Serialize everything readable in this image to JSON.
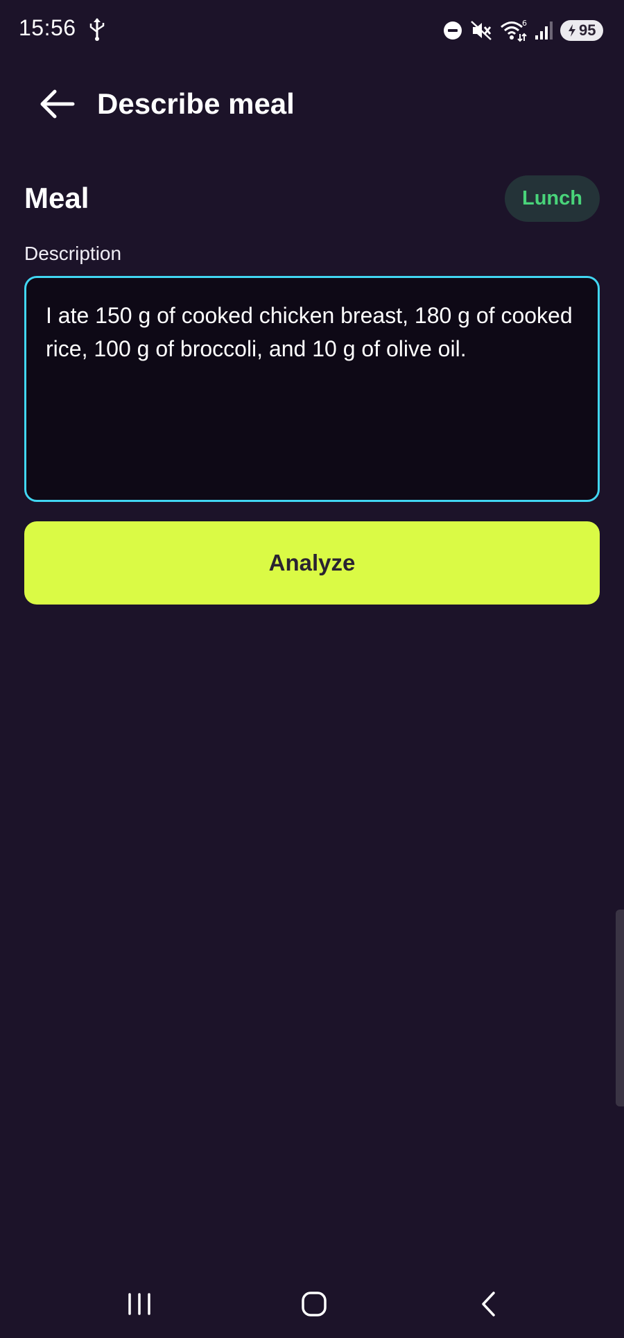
{
  "status_bar": {
    "time": "15:56",
    "battery": "95",
    "icons": [
      "usb-icon",
      "do-not-disturb-icon",
      "mute-icon",
      "wifi-icon",
      "signal-icon",
      "battery-charging-icon"
    ],
    "wifi_badge": "6"
  },
  "app_bar": {
    "title": "Describe meal",
    "back_icon": "arrow-left-icon"
  },
  "meal": {
    "heading": "Meal",
    "type_chip": "Lunch"
  },
  "description": {
    "label": "Description",
    "value": "I ate 150 g of cooked chicken breast, 180 g of cooked rice, 100 g of broccoli, and 10 g of olive oil."
  },
  "actions": {
    "analyze_label": "Analyze"
  },
  "navigation_bar": {
    "icons": [
      "recents-icon",
      "home-icon",
      "back-icon"
    ]
  },
  "colors": {
    "background": "#1c1329",
    "accent_button": "#dafa45",
    "field_border": "#41d6f2",
    "chip_text": "#49d47a",
    "chip_background": "#243338"
  }
}
